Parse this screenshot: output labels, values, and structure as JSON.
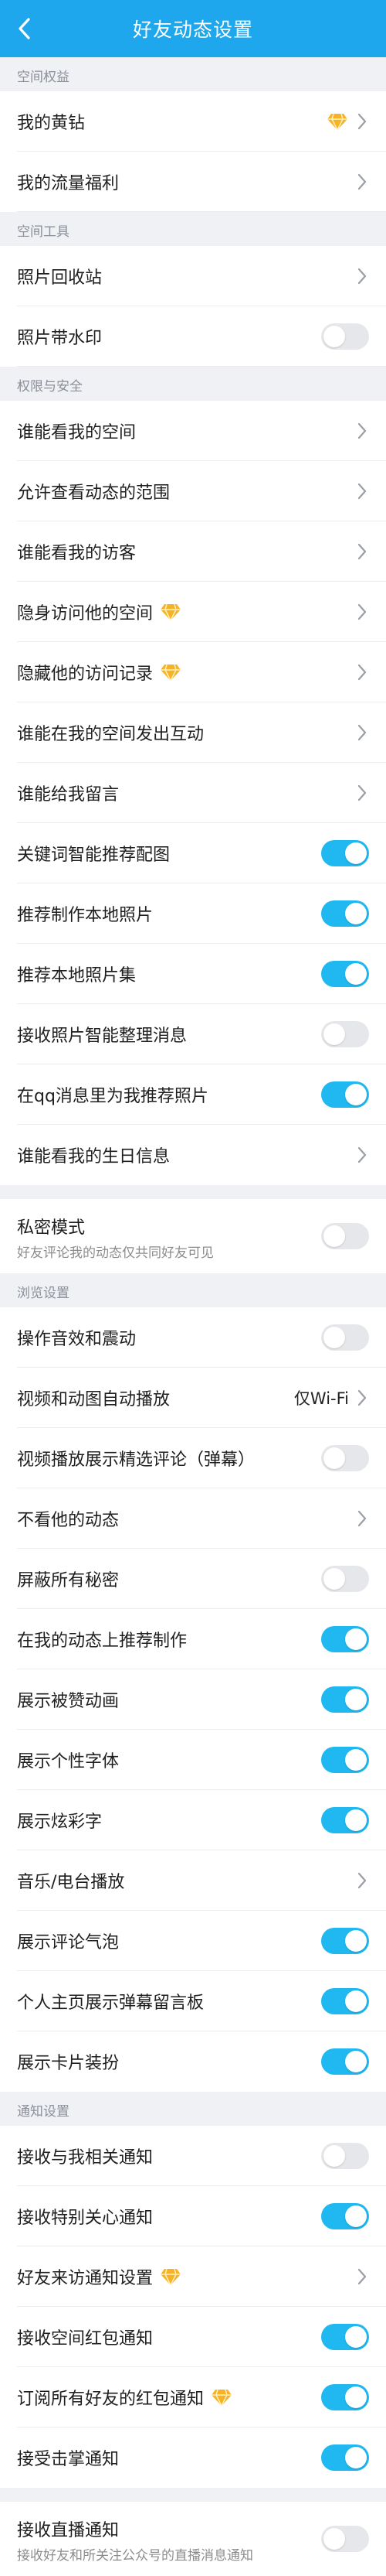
{
  "header": {
    "title": "好友动态设置"
  },
  "colors": {
    "accent": "#1fa7ee",
    "toggle_on": "#1fb8f0",
    "toggle_off": "#e6e7ea",
    "diamond": "#f5b325"
  },
  "sections": [
    {
      "title": "空间权益",
      "rows": [
        {
          "label": "我的黄钻",
          "name": "row-my-yellow-diamond",
          "control": "chevron",
          "right_icon": "diamond-icon"
        },
        {
          "label": "我的流量福利",
          "name": "row-my-traffic-benefits",
          "control": "chevron"
        }
      ]
    },
    {
      "title": "空间工具",
      "rows": [
        {
          "label": "照片回收站",
          "name": "row-photo-recycle-bin",
          "control": "chevron"
        },
        {
          "label": "照片带水印",
          "name": "row-photo-watermark",
          "control": "toggle",
          "on": false
        }
      ]
    },
    {
      "title": "权限与安全",
      "rows": [
        {
          "label": "谁能看我的空间",
          "name": "row-who-can-see-my-space",
          "control": "chevron"
        },
        {
          "label": "允许查看动态的范围",
          "name": "row-feed-visibility-range",
          "control": "chevron"
        },
        {
          "label": "谁能看我的访客",
          "name": "row-who-can-see-my-visitors",
          "control": "chevron"
        },
        {
          "label": "隐身访问他的空间",
          "name": "row-invisible-visit",
          "control": "chevron",
          "badge": true
        },
        {
          "label": "隐藏他的访问记录",
          "name": "row-hide-visit-records",
          "control": "chevron",
          "badge": true
        },
        {
          "label": "谁能在我的空间发出互动",
          "name": "row-who-can-interact",
          "control": "chevron"
        },
        {
          "label": "谁能给我留言",
          "name": "row-who-can-leave-message",
          "control": "chevron"
        },
        {
          "label": "关键词智能推荐配图",
          "name": "row-keyword-smart-images",
          "control": "toggle",
          "on": true
        },
        {
          "label": "推荐制作本地照片",
          "name": "row-recommend-local-photos",
          "control": "toggle",
          "on": true
        },
        {
          "label": "推荐本地照片集",
          "name": "row-recommend-local-albums",
          "control": "toggle",
          "on": true
        },
        {
          "label": "接收照片智能整理消息",
          "name": "row-photo-smart-organize",
          "control": "toggle",
          "on": false
        },
        {
          "label": "在qq消息里为我推荐照片",
          "name": "row-qq-recommend-photos",
          "control": "toggle",
          "on": true
        },
        {
          "label": "谁能看我的生日信息",
          "name": "row-who-can-see-birthday",
          "control": "chevron",
          "last": true
        }
      ]
    },
    {
      "gap": true,
      "rows": [
        {
          "label": "私密模式",
          "sub": "好友评论我的动态仅共同好友可见",
          "name": "row-private-mode",
          "control": "toggle",
          "on": false,
          "last": true,
          "tall": true
        }
      ]
    },
    {
      "title": "浏览设置",
      "rows": [
        {
          "label": "操作音效和震动",
          "name": "row-sound-vibration",
          "control": "toggle",
          "on": false
        },
        {
          "label": "视频和动图自动播放",
          "name": "row-video-autoplay",
          "control": "chevron",
          "value": "仅Wi-Fi"
        },
        {
          "label": "视频播放展示精选评论（弹幕）",
          "name": "row-video-danmaku",
          "control": "toggle",
          "on": false
        },
        {
          "label": "不看他的动态",
          "name": "row-hide-his-feed",
          "control": "chevron"
        },
        {
          "label": "屏蔽所有秘密",
          "name": "row-block-secrets",
          "control": "toggle",
          "on": false
        },
        {
          "label": "在我的动态上推荐制作",
          "name": "row-recommend-on-feed",
          "control": "toggle",
          "on": true
        },
        {
          "label": "展示被赞动画",
          "name": "row-like-animation",
          "control": "toggle",
          "on": true
        },
        {
          "label": "展示个性字体",
          "name": "row-custom-font",
          "control": "toggle",
          "on": true
        },
        {
          "label": "展示炫彩字",
          "name": "row-colorful-text",
          "control": "toggle",
          "on": true
        },
        {
          "label": "音乐/电台播放",
          "name": "row-music-radio",
          "control": "chevron"
        },
        {
          "label": "展示评论气泡",
          "name": "row-comment-bubble",
          "control": "toggle",
          "on": true
        },
        {
          "label": "个人主页展示弹幕留言板",
          "name": "row-danmaku-board",
          "control": "toggle",
          "on": true
        },
        {
          "label": "展示卡片装扮",
          "name": "row-card-decoration",
          "control": "toggle",
          "on": true,
          "last": true
        }
      ]
    },
    {
      "title": "通知设置",
      "rows": [
        {
          "label": "接收与我相关通知",
          "name": "row-related-notifications",
          "control": "toggle",
          "on": false
        },
        {
          "label": "接收特别关心通知",
          "name": "row-special-care-notifications",
          "control": "toggle",
          "on": true
        },
        {
          "label": "好友来访通知设置",
          "name": "row-visitor-notification-settings",
          "control": "chevron",
          "badge": true
        },
        {
          "label": "接收空间红包通知",
          "name": "row-red-packet-notifications",
          "control": "toggle",
          "on": true
        },
        {
          "label": "订阅所有好友的红包通知",
          "name": "row-subscribe-friend-red-packets",
          "control": "toggle",
          "on": true,
          "badge": true
        },
        {
          "label": "接受击掌通知",
          "name": "row-high-five-notifications",
          "control": "toggle",
          "on": true,
          "last": true
        }
      ]
    },
    {
      "gap": true,
      "rows": [
        {
          "label": "接收直播通知",
          "sub": "接收好友和所关注公众号的直播消息通知",
          "name": "row-live-notifications",
          "control": "toggle",
          "on": false,
          "last": true,
          "tall": true
        }
      ]
    }
  ]
}
